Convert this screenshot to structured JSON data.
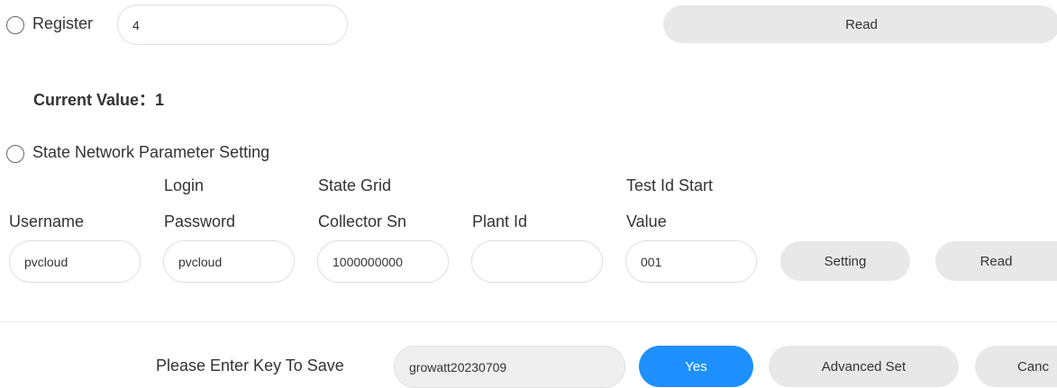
{
  "register": {
    "radio_label": "Register",
    "input_value": "4",
    "read_button": "Read"
  },
  "current_value": {
    "label": "Current Value：",
    "value": "1"
  },
  "state_network": {
    "radio_label": "State Network Parameter Setting",
    "fields": [
      {
        "label_line1": "",
        "label_line2": "Username",
        "value": "pvcloud"
      },
      {
        "label_line1": "Login",
        "label_line2": "Password",
        "value": "pvcloud"
      },
      {
        "label_line1": "State Grid",
        "label_line2": "Collector Sn",
        "value": "1000000000"
      },
      {
        "label_line1": "",
        "label_line2": "Plant Id",
        "value": ""
      },
      {
        "label_line1": "Test Id Start",
        "label_line2": "Value",
        "value": "001"
      }
    ],
    "setting_button": "Setting",
    "read_button": "Read"
  },
  "footer": {
    "key_prompt": "Please Enter Key To Save",
    "key_value": "growatt20230709",
    "yes_button": "Yes",
    "advanced_button": "Advanced Set",
    "cancel_button": "Canc"
  },
  "colors": {
    "primary": "#1e90ff",
    "button_grey": "#e8e8e8"
  }
}
